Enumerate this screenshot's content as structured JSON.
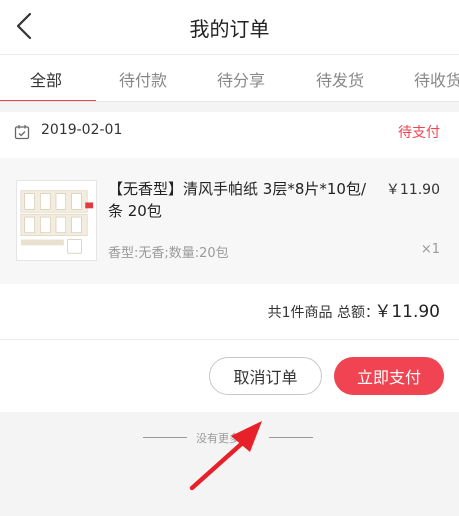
{
  "header": {
    "title": "我的订单",
    "back_icon": "chevron-left-icon"
  },
  "tabs": [
    {
      "label": "全部",
      "active": true
    },
    {
      "label": "待付款",
      "active": false
    },
    {
      "label": "待分享",
      "active": false
    },
    {
      "label": "待发货",
      "active": false
    },
    {
      "label": "待收货",
      "active": false
    }
  ],
  "order": {
    "date": "2019-02-01",
    "status": "待支付",
    "item": {
      "title": "【无香型】清风手帕纸 3层*8片*10包/条 20包",
      "price": "￥11.90",
      "spec": "香型:无香;数量:20包",
      "quantity": "×1"
    },
    "summary": {
      "label": "共1件商品 总额：",
      "amount": "￥11.90"
    },
    "buttons": {
      "cancel": "取消订单",
      "pay": "立即支付"
    }
  },
  "footer": {
    "no_more": "没有更多了"
  },
  "colors": {
    "accent": "#f04452",
    "annotation_arrow": "#e8202a"
  }
}
